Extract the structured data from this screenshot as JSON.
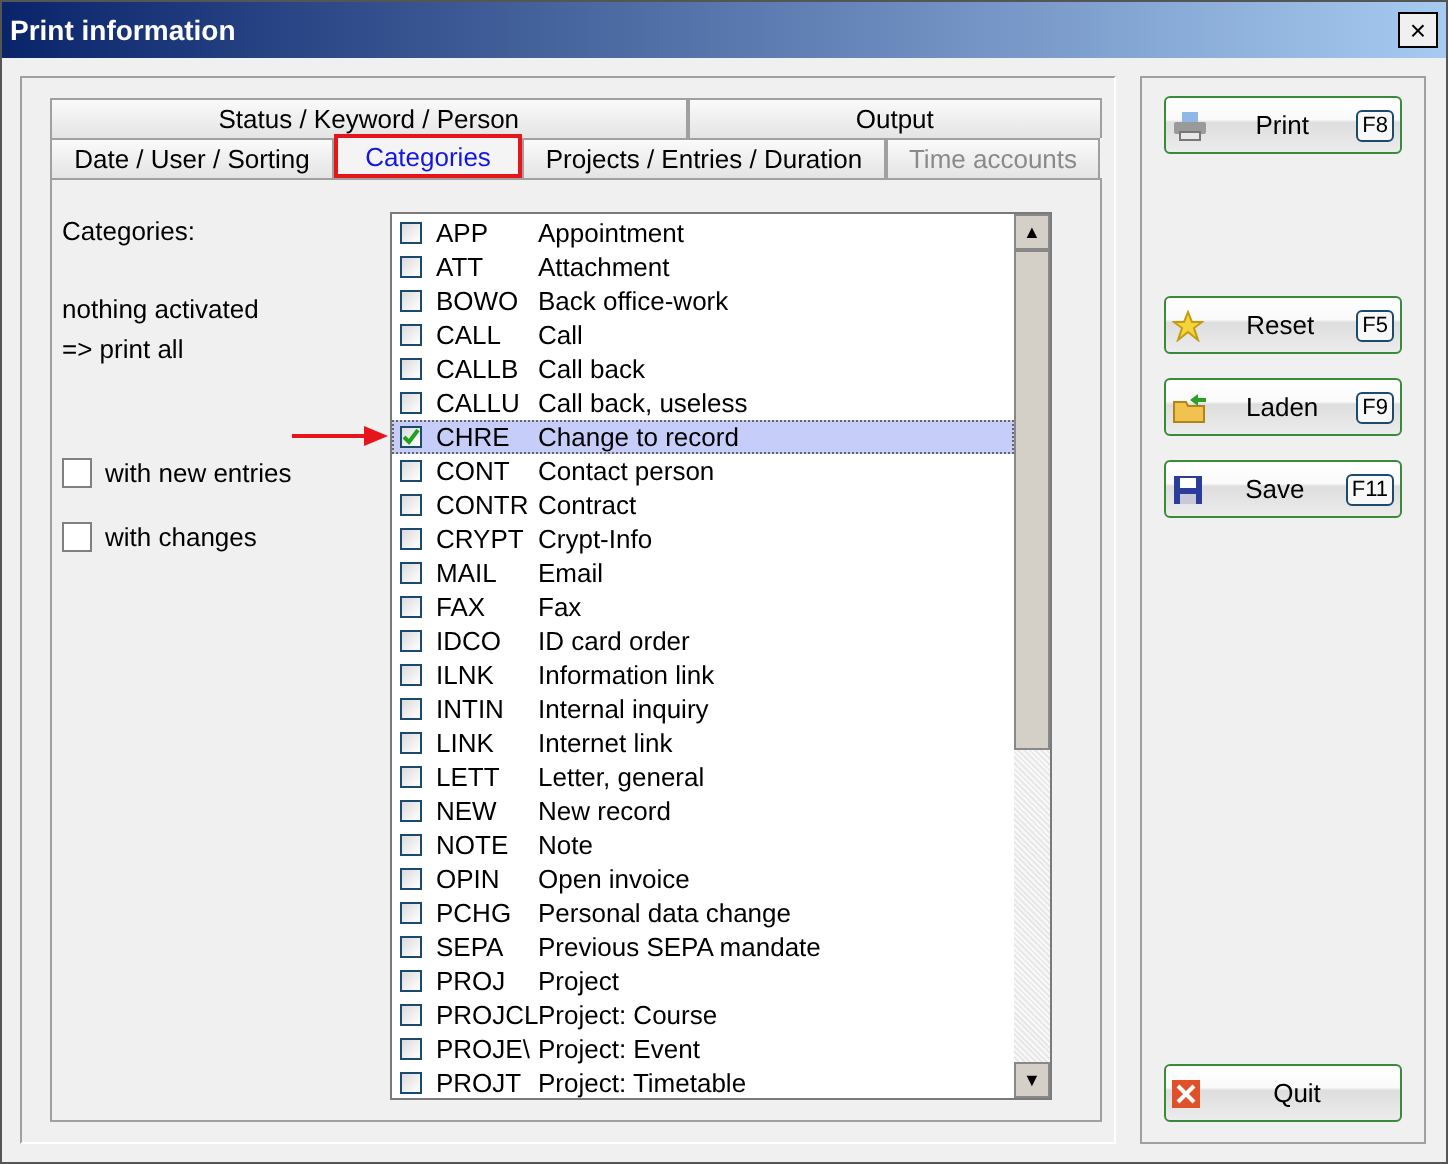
{
  "window": {
    "title": "Print information",
    "close": "×"
  },
  "tab_rows": [
    {
      "tabs": [
        {
          "label": "Status / Keyword / Person",
          "selected": false,
          "disabled": false,
          "highlighted": false
        },
        {
          "label": "Output",
          "selected": false,
          "disabled": false,
          "highlighted": false
        }
      ]
    },
    {
      "tabs": [
        {
          "label": "Date / User / Sorting",
          "selected": false,
          "disabled": false,
          "highlighted": false
        },
        {
          "label": "Categories",
          "selected": true,
          "disabled": false,
          "highlighted": true
        },
        {
          "label": "Projects / Entries / Duration",
          "selected": false,
          "disabled": false,
          "highlighted": false
        },
        {
          "label": "Time accounts",
          "selected": false,
          "disabled": true,
          "highlighted": false
        }
      ]
    }
  ],
  "categories_label": "Categories:",
  "hint_lines": [
    "nothing activated",
    "=> print all"
  ],
  "options": [
    {
      "label": "with new entries",
      "checked": false
    },
    {
      "label": "with changes",
      "checked": false
    }
  ],
  "categories": [
    {
      "code": "APP",
      "name": "Appointment",
      "checked": false,
      "selected": false,
      "pointed": false
    },
    {
      "code": "ATT",
      "name": "Attachment",
      "checked": false,
      "selected": false,
      "pointed": false
    },
    {
      "code": "BOWO",
      "name": "Back office-work",
      "checked": false,
      "selected": false,
      "pointed": false
    },
    {
      "code": "CALL",
      "name": "Call",
      "checked": false,
      "selected": false,
      "pointed": false
    },
    {
      "code": "CALLB",
      "name": "Call back",
      "checked": false,
      "selected": false,
      "pointed": false
    },
    {
      "code": "CALLU",
      "name": "Call back, useless",
      "checked": false,
      "selected": false,
      "pointed": false
    },
    {
      "code": "CHRE",
      "name": "Change to record",
      "checked": true,
      "selected": true,
      "pointed": true
    },
    {
      "code": "CONT",
      "name": "Contact person",
      "checked": false,
      "selected": false,
      "pointed": false
    },
    {
      "code": "CONTR",
      "name": "Contract",
      "checked": false,
      "selected": false,
      "pointed": false
    },
    {
      "code": "CRYPT",
      "name": "Crypt-Info",
      "checked": false,
      "selected": false,
      "pointed": false
    },
    {
      "code": "MAIL",
      "name": "Email",
      "checked": false,
      "selected": false,
      "pointed": false
    },
    {
      "code": "FAX",
      "name": "Fax",
      "checked": false,
      "selected": false,
      "pointed": false
    },
    {
      "code": "IDCO",
      "name": "ID card order",
      "checked": false,
      "selected": false,
      "pointed": false
    },
    {
      "code": "ILNK",
      "name": "Information link",
      "checked": false,
      "selected": false,
      "pointed": false
    },
    {
      "code": "INTIN",
      "name": "Internal inquiry",
      "checked": false,
      "selected": false,
      "pointed": false
    },
    {
      "code": "LINK",
      "name": "Internet link",
      "checked": false,
      "selected": false,
      "pointed": false
    },
    {
      "code": "LETT",
      "name": "Letter, general",
      "checked": false,
      "selected": false,
      "pointed": false
    },
    {
      "code": "NEW",
      "name": "New record",
      "checked": false,
      "selected": false,
      "pointed": false
    },
    {
      "code": "NOTE",
      "name": "Note",
      "checked": false,
      "selected": false,
      "pointed": false
    },
    {
      "code": "OPIN",
      "name": "Open invoice",
      "checked": false,
      "selected": false,
      "pointed": false
    },
    {
      "code": "PCHG",
      "name": "Personal data change",
      "checked": false,
      "selected": false,
      "pointed": false
    },
    {
      "code": "SEPA",
      "name": "Previous SEPA mandate",
      "checked": false,
      "selected": false,
      "pointed": false
    },
    {
      "code": "PROJ",
      "name": "Project",
      "checked": false,
      "selected": false,
      "pointed": false
    },
    {
      "code": "PROJCL",
      "name": "Project: Course",
      "checked": false,
      "selected": false,
      "pointed": false
    },
    {
      "code": "PROJE\\",
      "name": "Project: Event",
      "checked": false,
      "selected": false,
      "pointed": false
    },
    {
      "code": "PROJT",
      "name": "Project: Timetable",
      "checked": false,
      "selected": false,
      "pointed": false
    }
  ],
  "scrollbar": {
    "up": "▲",
    "down": "▼"
  },
  "button_groups": [
    {
      "buttons": [
        {
          "label": "Print",
          "key": "F8",
          "kind": "printer"
        }
      ]
    },
    {
      "buttons": [
        {
          "label": "Reset",
          "key": "F5",
          "kind": "star"
        },
        {
          "label": "Laden",
          "key": "F9",
          "kind": "folder"
        },
        {
          "label": "Save",
          "key": "F11",
          "kind": "disk"
        }
      ]
    },
    {
      "buttons": [
        {
          "label": "Quit",
          "kind": "quit"
        }
      ]
    }
  ]
}
